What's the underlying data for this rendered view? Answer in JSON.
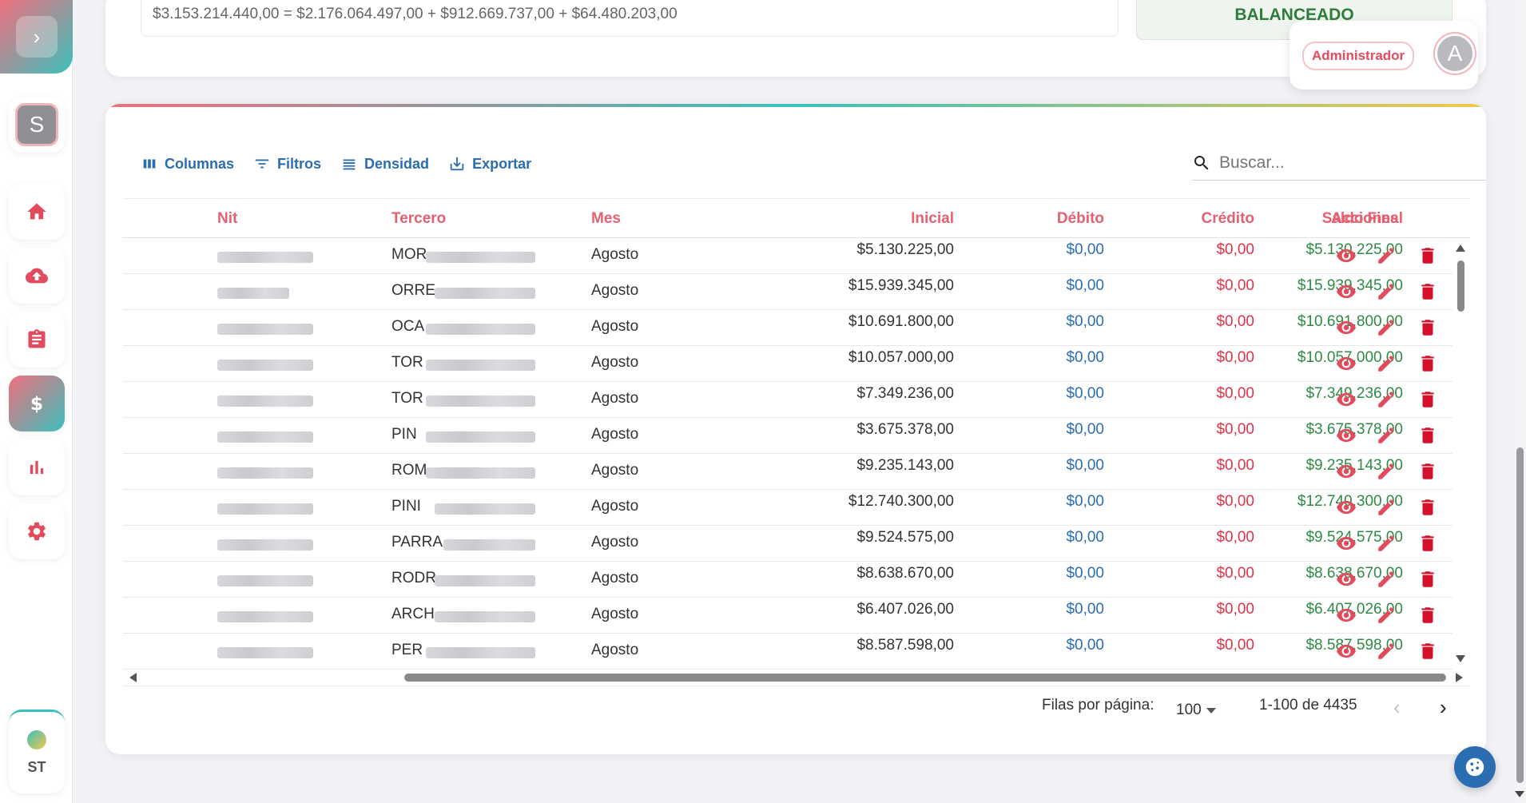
{
  "sidebar": {
    "toggle_icon": "chevron-right-icon",
    "org_initial": "S",
    "items": [
      {
        "name": "home",
        "icon": "home-icon",
        "active": false
      },
      {
        "name": "upload",
        "icon": "cloud-upload-icon",
        "active": false
      },
      {
        "name": "clipboard",
        "icon": "clipboard-icon",
        "active": false
      },
      {
        "name": "finance",
        "icon": "dollar-icon",
        "active": true
      },
      {
        "name": "reports",
        "icon": "bar-chart-icon",
        "active": false
      },
      {
        "name": "settings",
        "icon": "gear-icon",
        "active": false
      }
    ],
    "bottom_label": "ST"
  },
  "summary": {
    "formula": "$3.153.214.440,00 = $2.176.064.497,00 + $912.669.737,00 + $64.480.203,00",
    "status": "BALANCEADO"
  },
  "user": {
    "role": "Administrador",
    "initial": "A"
  },
  "toolbar": {
    "columns_label": "Columnas",
    "filters_label": "Filtros",
    "density_label": "Densidad",
    "export_label": "Exportar"
  },
  "search": {
    "placeholder": "Buscar..."
  },
  "grid": {
    "columns": {
      "nit": "Nit",
      "tercero": "Tercero",
      "mes": "Mes",
      "inicial": "Inicial",
      "debito": "Débito",
      "credito": "Crédito",
      "saldo_final": "Saldo Final",
      "acciones": "Acciones"
    },
    "rows": [
      {
        "tercero": "MOR",
        "mes": "Agosto",
        "inicial": "$5.130.225,00",
        "debito": "$0,00",
        "credito": "$0,00",
        "saldo_final": "$5.130.225,00"
      },
      {
        "tercero": "ORRE",
        "mes": "Agosto",
        "inicial": "$15.939.345,00",
        "debito": "$0,00",
        "credito": "$0,00",
        "saldo_final": "$15.939.345,00"
      },
      {
        "tercero": "OCA",
        "mes": "Agosto",
        "inicial": "$10.691.800,00",
        "debito": "$0,00",
        "credito": "$0,00",
        "saldo_final": "$10.691.800,00"
      },
      {
        "tercero": "TOR",
        "mes": "Agosto",
        "inicial": "$10.057.000,00",
        "debito": "$0,00",
        "credito": "$0,00",
        "saldo_final": "$10.057.000,00"
      },
      {
        "tercero": "TOR",
        "mes": "Agosto",
        "inicial": "$7.349.236,00",
        "debito": "$0,00",
        "credito": "$0,00",
        "saldo_final": "$7.349.236,00"
      },
      {
        "tercero": "PIN",
        "mes": "Agosto",
        "inicial": "$3.675.378,00",
        "debito": "$0,00",
        "credito": "$0,00",
        "saldo_final": "$3.675.378,00"
      },
      {
        "tercero": "ROM",
        "mes": "Agosto",
        "inicial": "$9.235.143,00",
        "debito": "$0,00",
        "credito": "$0,00",
        "saldo_final": "$9.235.143,00"
      },
      {
        "tercero": "PINI",
        "mes": "Agosto",
        "inicial": "$12.740.300,00",
        "debito": "$0,00",
        "credito": "$0,00",
        "saldo_final": "$12.740.300,00"
      },
      {
        "tercero": "PARRA",
        "mes": "Agosto",
        "inicial": "$9.524.575,00",
        "debito": "$0,00",
        "credito": "$0,00",
        "saldo_final": "$9.524.575,00"
      },
      {
        "tercero": "RODR",
        "mes": "Agosto",
        "inicial": "$8.638.670,00",
        "debito": "$0,00",
        "credito": "$0,00",
        "saldo_final": "$8.638.670,00"
      },
      {
        "tercero": "ARCH",
        "mes": "Agosto",
        "inicial": "$6.407.026,00",
        "debito": "$0,00",
        "credito": "$0,00",
        "saldo_final": "$6.407.026,00"
      },
      {
        "tercero": "PER",
        "mes": "Agosto",
        "inicial": "$8.587.598,00",
        "debito": "$0,00",
        "credito": "$0,00",
        "saldo_final": "$8.587.598,00"
      }
    ],
    "row_actions": [
      "eye-icon",
      "pencil-icon",
      "trash-icon"
    ]
  },
  "pagination": {
    "rows_per_page_label": "Filas por página:",
    "rows_per_page": "100",
    "range": "1-100 de 4435"
  },
  "colors": {
    "accent_pink": "#e56070",
    "accent_teal": "#3bc0bb",
    "link_blue": "#2a6db0",
    "positive_green": "#2f8a45",
    "negative_red": "#e0334a"
  }
}
